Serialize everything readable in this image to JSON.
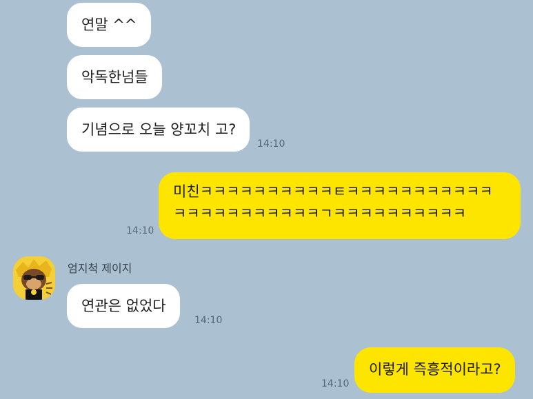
{
  "chat": {
    "messages": [
      {
        "text": "연말 ^^"
      },
      {
        "text": "악독한넘들"
      },
      {
        "text": "기념으로 오늘 양꼬치 고?",
        "time": "14:10"
      },
      {
        "text": "미친ㅋㅋㅋㅋㅋㅋㅋㅋㅋㅋㅌㅋㅋㅋㅋㅋㅋㅋㅋㅋㅋㅋㅋㅋㅋㅋㅋㅋㅋㅋㅋㅋㅋㄱㅋㅋㅋㅋㅋㅋㅋㅋㅋㅋ",
        "time": "14:10"
      },
      {
        "text": "연관은 없었다",
        "time": "14:10"
      },
      {
        "text": "이렇게 즉흥적이라고?",
        "time": "14:10"
      }
    ],
    "other_sender": {
      "name": "엄지척 제이지",
      "avatar_icon": "jay-g-character-avatar-icon"
    }
  },
  "colors": {
    "background": "#abc1d1",
    "outgoing_bubble": "#fee500",
    "incoming_bubble": "#ffffff"
  }
}
